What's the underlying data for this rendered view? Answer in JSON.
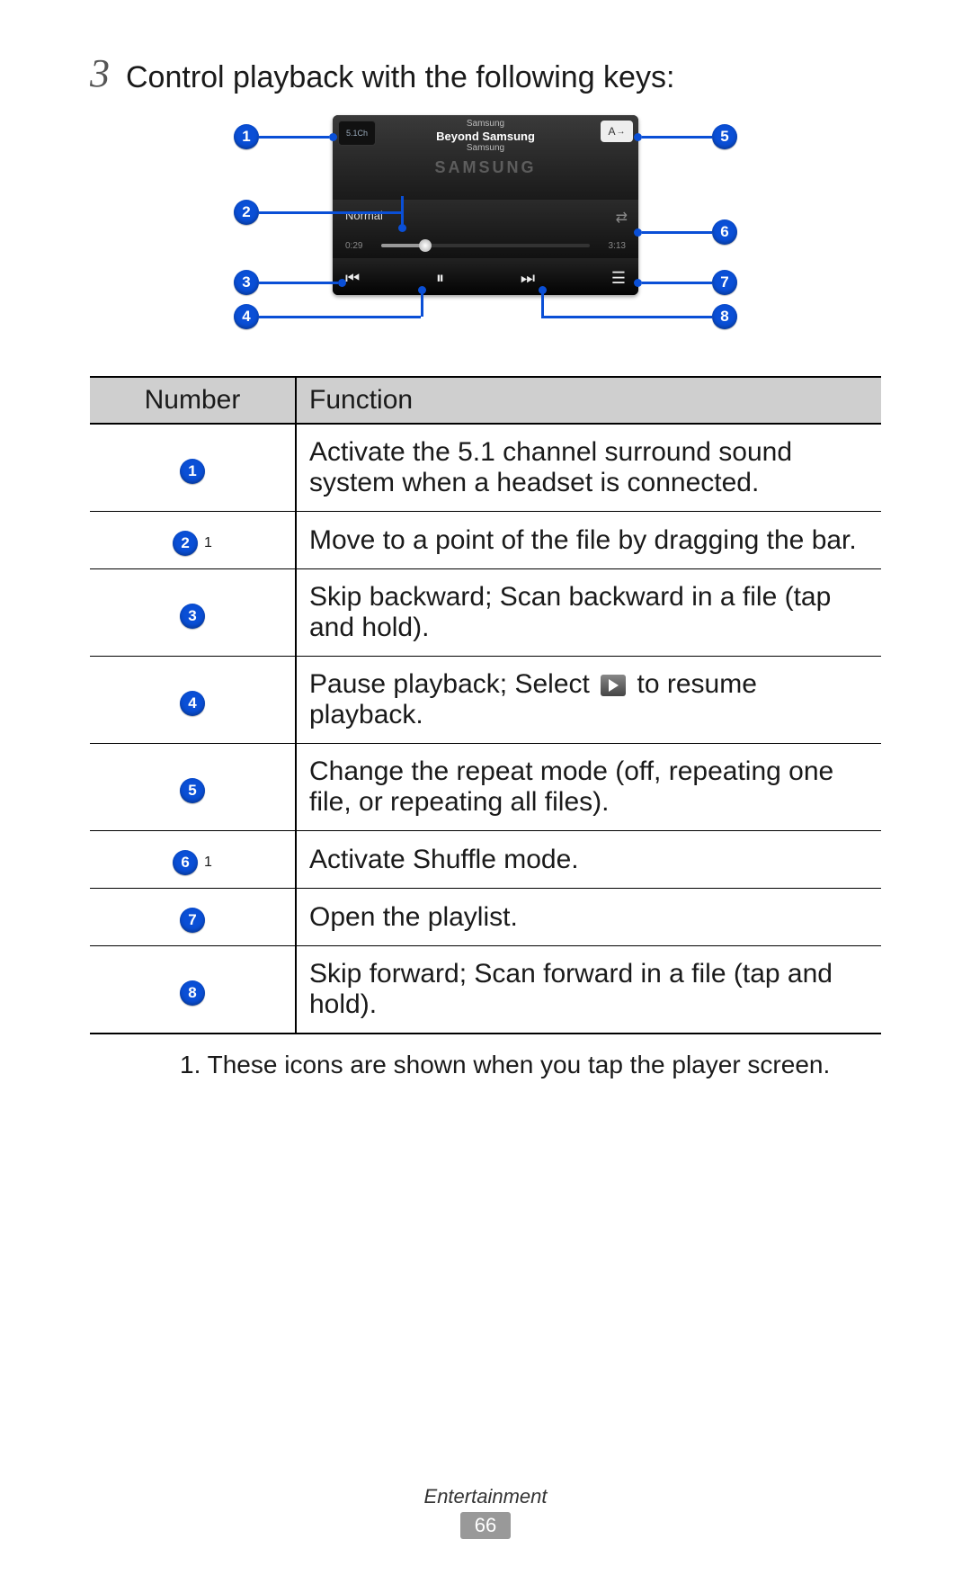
{
  "step_number": "3",
  "step_text": "Control playback with the following keys:",
  "player": {
    "artist_top": "Samsung",
    "track_title": "Beyond Samsung",
    "artist_bottom": "Samsung",
    "brand_text": "SAMSUNG",
    "surround_label": "5.1Ch",
    "repeat_label": "A",
    "eq_label": "Normal",
    "time_elapsed": "0:29",
    "time_total": "3:13"
  },
  "callouts": [
    "1",
    "2",
    "3",
    "4",
    "5",
    "6",
    "7",
    "8"
  ],
  "table": {
    "headers": {
      "col1": "Number",
      "col2": "Function"
    },
    "rows": [
      {
        "num": "1",
        "sup": "",
        "func_pre": "Activate the 5.1 channel surround sound system when a headset is connected.",
        "play_icon": false,
        "func_post": ""
      },
      {
        "num": "2",
        "sup": "1",
        "func_pre": "Move to a point of the file by dragging the bar.",
        "play_icon": false,
        "func_post": ""
      },
      {
        "num": "3",
        "sup": "",
        "func_pre": "Skip backward; Scan backward in a file (tap and hold).",
        "play_icon": false,
        "func_post": ""
      },
      {
        "num": "4",
        "sup": "",
        "func_pre": "Pause playback; Select ",
        "play_icon": true,
        "func_post": " to resume playback."
      },
      {
        "num": "5",
        "sup": "",
        "func_pre": "Change the repeat mode (off, repeating one file, or repeating all files).",
        "play_icon": false,
        "func_post": ""
      },
      {
        "num": "6",
        "sup": "1",
        "func_pre": "Activate Shuffle mode.",
        "play_icon": false,
        "func_post": ""
      },
      {
        "num": "7",
        "sup": "",
        "func_pre": "Open the playlist.",
        "play_icon": false,
        "func_post": ""
      },
      {
        "num": "8",
        "sup": "",
        "func_pre": "Skip forward; Scan forward in a file (tap and hold).",
        "play_icon": false,
        "func_post": ""
      }
    ]
  },
  "footnote": "1.  These icons are shown when you tap the player screen.",
  "footer": {
    "section": "Entertainment",
    "page": "66"
  }
}
